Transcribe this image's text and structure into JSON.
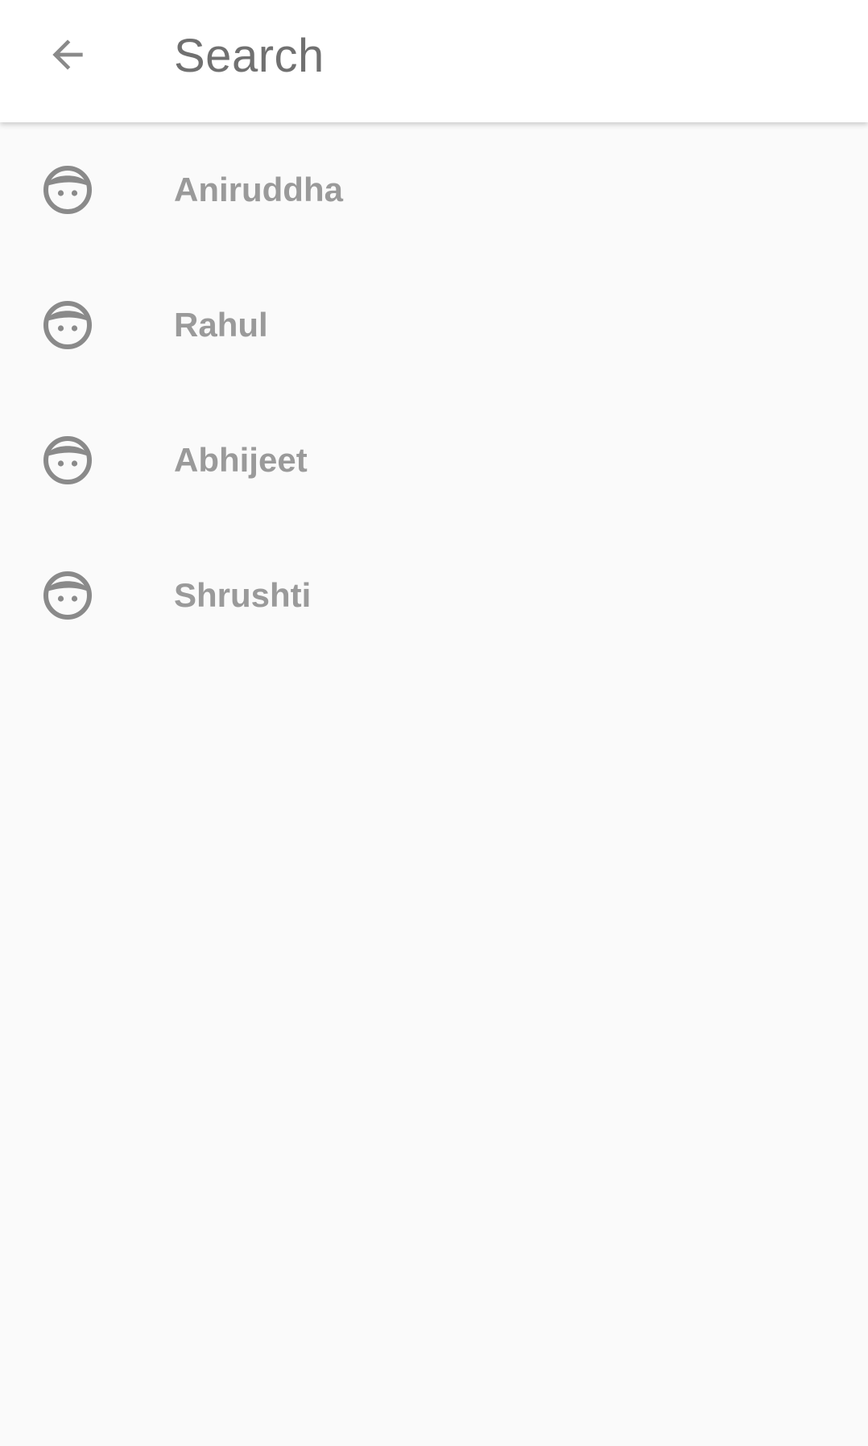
{
  "header": {
    "title": "Search",
    "back_icon": "arrow-back-icon"
  },
  "contacts": [
    {
      "name": "Aniruddha",
      "icon": "face-icon"
    },
    {
      "name": "Rahul",
      "icon": "face-icon"
    },
    {
      "name": "Abhijeet",
      "icon": "face-icon"
    },
    {
      "name": "Shrushti",
      "icon": "face-icon"
    }
  ],
  "colors": {
    "background": "#fafafa",
    "toolbar": "#ffffff",
    "title_text": "#707070",
    "item_text": "#9a9a9a",
    "icon": "#8a8a8a"
  }
}
